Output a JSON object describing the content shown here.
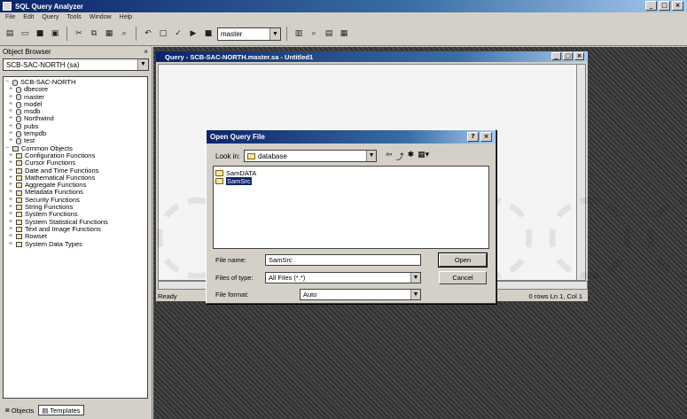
{
  "app": {
    "title": "SQL Query Analyzer",
    "min": "_",
    "max": "□",
    "close": "×"
  },
  "menu": [
    "File",
    "Edit",
    "Query",
    "Tools",
    "Window",
    "Help"
  ],
  "toolbar": {
    "database": "master"
  },
  "object_browser": {
    "title": "Object Browser",
    "close": "×",
    "server": "SCB-SAC-NORTH (sa)",
    "root": "SCB-SAC-NORTH",
    "databases": [
      "dbecore",
      "master",
      "model",
      "msdb",
      "Northwind",
      "pubs",
      "tempdb",
      "test"
    ],
    "common_objects_label": "Common Objects",
    "common_objects": [
      "Configuration Functions",
      "Cursor Functions",
      "Date and Time Functions",
      "Mathematical Functions",
      "Aggregate Functions",
      "Metadata Functions",
      "Security Functions",
      "String Functions",
      "System Functions",
      "System Statistical Functions",
      "Text and Image Functions",
      "Rowset",
      "System Data Types"
    ],
    "tabs": [
      "Objects",
      "Templates"
    ]
  },
  "query_window": {
    "title": "Query - SCB-SAC-NORTH.master.sa - Untitled1",
    "status_left": "Ready",
    "status_right": "0 rows   Ln 1, Col 1"
  },
  "dialog": {
    "title": "Open Query File",
    "help": "?",
    "close": "×",
    "look_in_label": "Look in:",
    "look_in_value": "database",
    "files": [
      "SamDATA",
      "SamSrc"
    ],
    "file_name_label": "File name:",
    "file_name_value": "SamSrc",
    "file_type_label": "Files of type:",
    "file_type_value": "All Files (*.*)",
    "file_format_label": "File format:",
    "file_format_value": "Auto",
    "open_label": "Open",
    "cancel_label": "Cancel"
  }
}
